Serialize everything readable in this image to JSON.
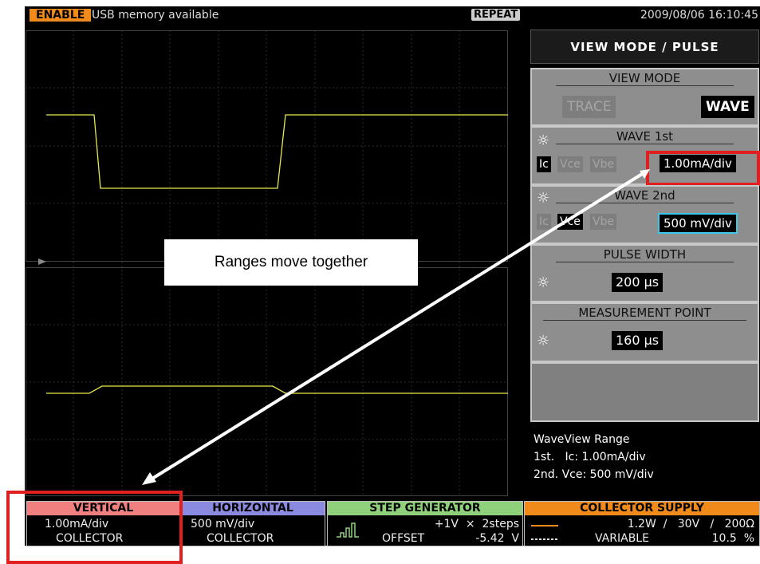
{
  "status_bar": {
    "enable_label": "ENABLE",
    "usb_text": "USB memory available",
    "repeat_label": "REPEAT",
    "datetime": "2009/08/06 16:10:45"
  },
  "side_menu": {
    "title": "VIEW MODE / PULSE",
    "view_mode": {
      "title": "VIEW MODE",
      "options": [
        "TRACE",
        "WAVE"
      ],
      "selected": "WAVE"
    },
    "wave_1st": {
      "title": "WAVE 1st",
      "channels": [
        "Ic",
        "Vce",
        "Vbe"
      ],
      "selected": "Ic",
      "range": "1.00mA/div"
    },
    "wave_2nd": {
      "title": "WAVE 2nd",
      "channels": [
        "Ic",
        "Vce",
        "Vbe"
      ],
      "selected": "Vce",
      "range": "500 mV/div"
    },
    "pulse_width": {
      "title": "PULSE WIDTH",
      "value": "200 µs"
    },
    "measurement_point": {
      "title": "MEASUREMENT POINT",
      "value": "160 µs"
    }
  },
  "waveview_info": {
    "line1": "WaveView Range",
    "line2": "1st.   Ic: 1.00mA/div",
    "line3": "2nd. Vce: 500 mV/div"
  },
  "bottom_bar": {
    "vertical": {
      "title": "VERTICAL",
      "line1": "1.00mA/div",
      "line2": "COLLECTOR"
    },
    "horizontal": {
      "title": "HORIZONTAL",
      "line1": "500 mV/div",
      "line2": "COLLECTOR"
    },
    "step_generator": {
      "title": "STEP GENERATOR",
      "line1": "+1V  ×  2steps",
      "line2_label": "OFFSET",
      "line2_value": "-5.42  V"
    },
    "collector_supply": {
      "title": "COLLECTOR SUPPLY",
      "line1": "1.2W  /   30V   /   200Ω",
      "line2_label": "VARIABLE",
      "line2_value": "10.5  %"
    }
  },
  "annotation": {
    "callout_text": "Ranges move together"
  },
  "colors": {
    "trace": "#e8e84a",
    "enable": "#f08a1a",
    "vertical_header": "#f08080",
    "horizontal_header": "#8a8ae0",
    "step_header": "#8fd17a",
    "collector_header": "#f08a1a",
    "highlight_red": "#e02020",
    "cyan_box": "#3cc8e8"
  }
}
